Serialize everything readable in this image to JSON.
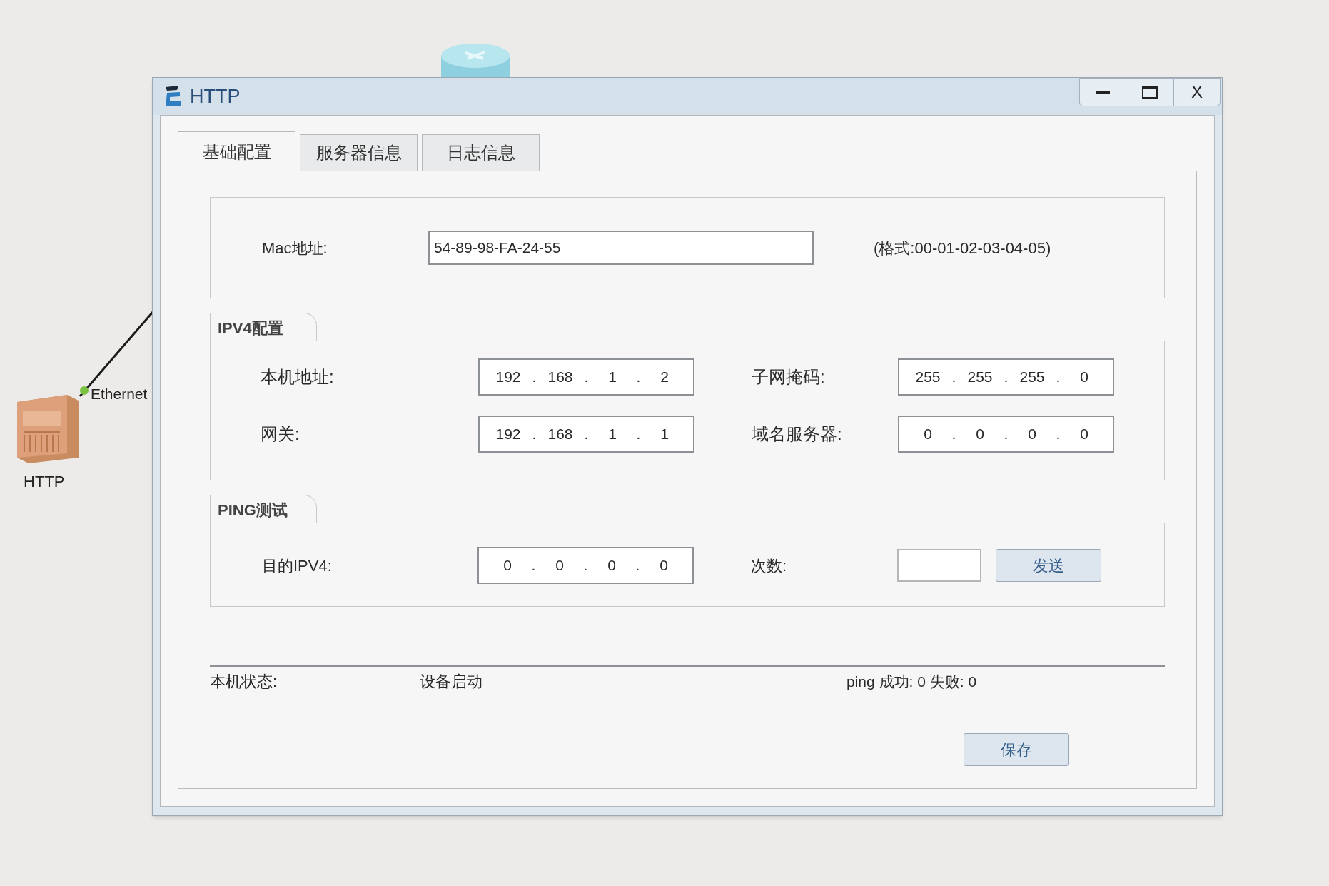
{
  "canvas": {
    "device_label": "HTTP",
    "port_label": "Ethernet"
  },
  "window": {
    "title": "HTTP",
    "close_label": "X"
  },
  "tabs": [
    {
      "label": "基础配置",
      "selected": true
    },
    {
      "label": "服务器信息",
      "selected": false
    },
    {
      "label": "日志信息",
      "selected": false
    }
  ],
  "mac": {
    "label": "Mac地址:",
    "value": "54-89-98-FA-24-55",
    "hint": "(格式:00-01-02-03-04-05)"
  },
  "separator": ".",
  "ipv4": {
    "title": "IPV4配置",
    "fields": [
      {
        "label": "本机地址:",
        "octets": [
          "192",
          "168",
          "1",
          "2"
        ]
      },
      {
        "label": "子网掩码:",
        "octets": [
          "255",
          "255",
          "255",
          "0"
        ]
      },
      {
        "label": "网关:",
        "octets": [
          "192",
          "168",
          "1",
          "1"
        ]
      },
      {
        "label": "域名服务器:",
        "octets": [
          "0",
          "0",
          "0",
          "0"
        ]
      }
    ]
  },
  "ping": {
    "title": "PING测试",
    "dest_label": "目的IPV4:",
    "dest_octets": [
      "0",
      "0",
      "0",
      "0"
    ],
    "count_label": "次数:",
    "send_button": "发送"
  },
  "status": {
    "label": "本机状态:",
    "value": "设备启动",
    "result": "ping 成功: 0 失败: 0"
  },
  "save_button": "保存"
}
